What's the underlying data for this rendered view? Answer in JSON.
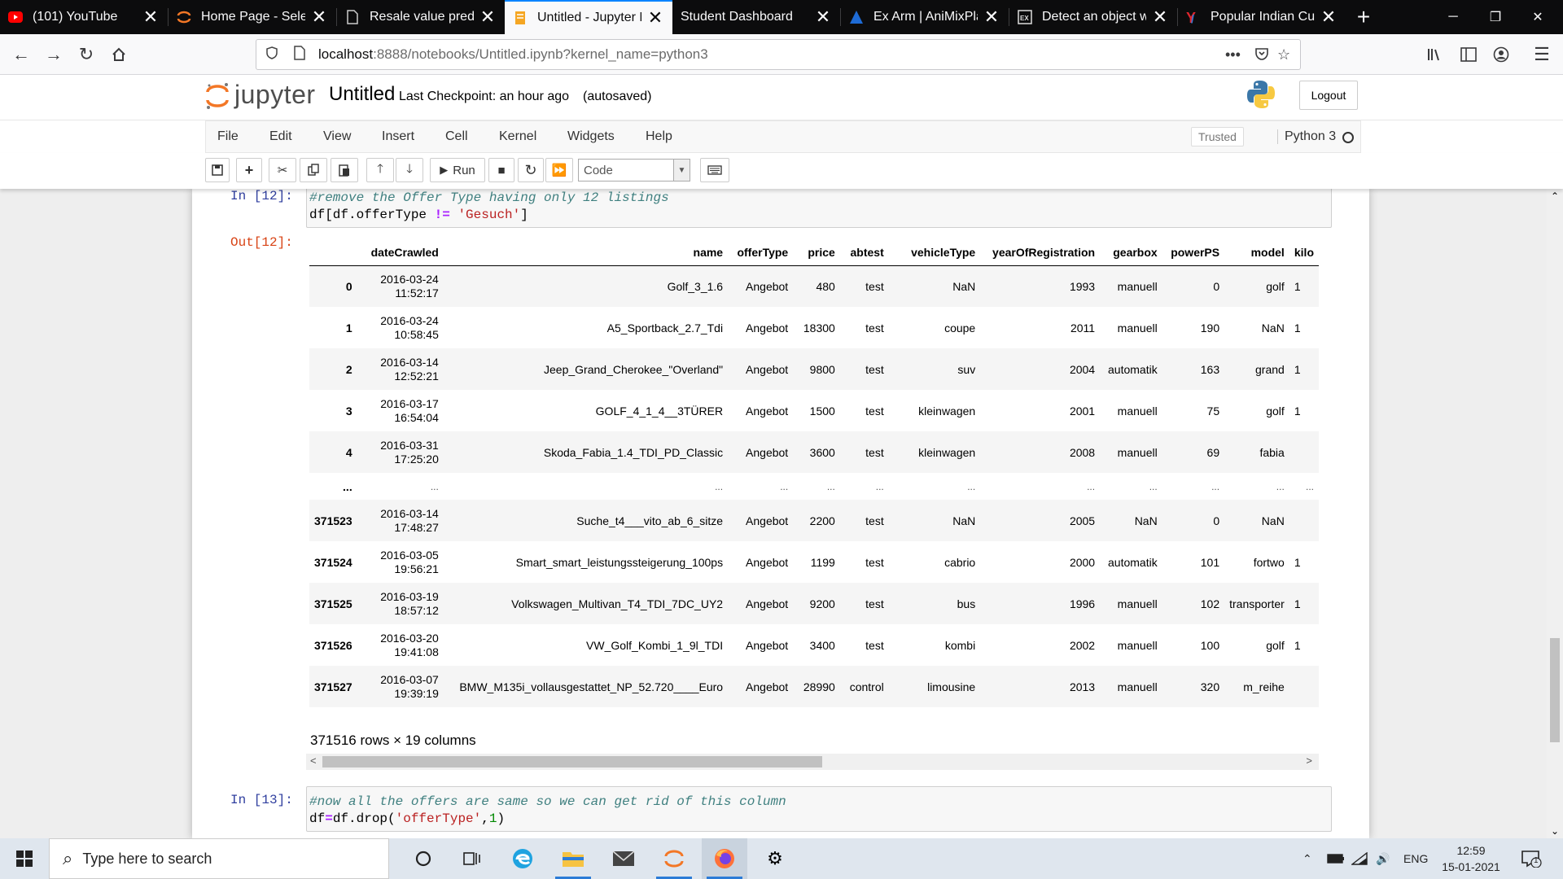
{
  "browser": {
    "tabs": [
      {
        "title": "(101) YouTube",
        "icon": "youtube-icon",
        "active": false
      },
      {
        "title": "Home Page - Select",
        "icon": "jupyter-tab-icon",
        "active": false
      },
      {
        "title": "Resale value predic",
        "icon": "document-icon",
        "active": false
      },
      {
        "title": "Untitled - Jupyter N",
        "icon": "jupyter-notebook-icon",
        "active": true
      },
      {
        "title": "Student Dashboard",
        "icon": "",
        "active": false
      },
      {
        "title": "Ex Arm | AniMixPlay",
        "icon": "animixplay-icon",
        "active": false
      },
      {
        "title": "Detect an object wi",
        "icon": "exe-icon",
        "active": false
      },
      {
        "title": "Popular Indian Cute",
        "icon": "y-icon",
        "active": false
      }
    ],
    "url_host": "localhost",
    "url_rest": ":8888/notebooks/Untitled.ipynb?kernel_name=python3"
  },
  "jupyter": {
    "logo_text": "jupyter",
    "notebook_name": "Untitled",
    "checkpoint": "Last Checkpoint: an hour ago",
    "autosave": "(autosaved)",
    "logout": "Logout",
    "menu": [
      "File",
      "Edit",
      "View",
      "Insert",
      "Cell",
      "Kernel",
      "Widgets",
      "Help"
    ],
    "trusted": "Trusted",
    "kernel": "Python 3",
    "toolbar": {
      "run_label": "Run",
      "cell_type": "Code"
    }
  },
  "cells": {
    "cell12": {
      "in_prompt": "In [12]:",
      "out_prompt": "Out[12]:",
      "line1": "#remove the Offer Type having only 12 listings",
      "line2_a": "df[df.offerType ",
      "line2_op": "!=",
      "line2_b": " ",
      "line2_str": "'Gesuch'",
      "line2_c": "]"
    },
    "cell13": {
      "in_prompt": "In [13]:",
      "line1": "#now all the offers are same so we can get rid of this column",
      "line2_a": "df",
      "line2_op": "=",
      "line2_b": "df.drop(",
      "line2_str": "'offerType'",
      "line2_c": ",",
      "line2_num": "1",
      "line2_d": ")"
    }
  },
  "dataframe": {
    "columns": [
      "",
      "dateCrawled",
      "name",
      "offerType",
      "price",
      "abtest",
      "vehicleType",
      "yearOfRegistration",
      "gearbox",
      "powerPS",
      "model",
      "kilo"
    ],
    "rows": [
      {
        "idx": "0",
        "date": "2016-03-24",
        "time": "11:52:17",
        "name": "Golf_3_1.6",
        "offerType": "Angebot",
        "price": "480",
        "abtest": "test",
        "vehicleType": "NaN",
        "year": "1993",
        "gearbox": "manuell",
        "powerPS": "0",
        "model": "golf",
        "kilo": "1"
      },
      {
        "idx": "1",
        "date": "2016-03-24",
        "time": "10:58:45",
        "name": "A5_Sportback_2.7_Tdi",
        "offerType": "Angebot",
        "price": "18300",
        "abtest": "test",
        "vehicleType": "coupe",
        "year": "2011",
        "gearbox": "manuell",
        "powerPS": "190",
        "model": "NaN",
        "kilo": "1"
      },
      {
        "idx": "2",
        "date": "2016-03-14",
        "time": "12:52:21",
        "name": "Jeep_Grand_Cherokee_\"Overland\"",
        "offerType": "Angebot",
        "price": "9800",
        "abtest": "test",
        "vehicleType": "suv",
        "year": "2004",
        "gearbox": "automatik",
        "powerPS": "163",
        "model": "grand",
        "kilo": "1"
      },
      {
        "idx": "3",
        "date": "2016-03-17",
        "time": "16:54:04",
        "name": "GOLF_4_1_4__3TÜRER",
        "offerType": "Angebot",
        "price": "1500",
        "abtest": "test",
        "vehicleType": "kleinwagen",
        "year": "2001",
        "gearbox": "manuell",
        "powerPS": "75",
        "model": "golf",
        "kilo": "1"
      },
      {
        "idx": "4",
        "date": "2016-03-31",
        "time": "17:25:20",
        "name": "Skoda_Fabia_1.4_TDI_PD_Classic",
        "offerType": "Angebot",
        "price": "3600",
        "abtest": "test",
        "vehicleType": "kleinwagen",
        "year": "2008",
        "gearbox": "manuell",
        "powerPS": "69",
        "model": "fabia",
        "kilo": ""
      },
      {
        "idx": "...",
        "ellipsis": true
      },
      {
        "idx": "371523",
        "date": "2016-03-14",
        "time": "17:48:27",
        "name": "Suche_t4___vito_ab_6_sitze",
        "offerType": "Angebot",
        "price": "2200",
        "abtest": "test",
        "vehicleType": "NaN",
        "year": "2005",
        "gearbox": "NaN",
        "powerPS": "0",
        "model": "NaN",
        "kilo": ""
      },
      {
        "idx": "371524",
        "date": "2016-03-05",
        "time": "19:56:21",
        "name": "Smart_smart_leistungssteigerung_100ps",
        "offerType": "Angebot",
        "price": "1199",
        "abtest": "test",
        "vehicleType": "cabrio",
        "year": "2000",
        "gearbox": "automatik",
        "powerPS": "101",
        "model": "fortwo",
        "kilo": "1"
      },
      {
        "idx": "371525",
        "date": "2016-03-19",
        "time": "18:57:12",
        "name": "Volkswagen_Multivan_T4_TDI_7DC_UY2",
        "offerType": "Angebot",
        "price": "9200",
        "abtest": "test",
        "vehicleType": "bus",
        "year": "1996",
        "gearbox": "manuell",
        "powerPS": "102",
        "model": "transporter",
        "kilo": "1"
      },
      {
        "idx": "371526",
        "date": "2016-03-20",
        "time": "19:41:08",
        "name": "VW_Golf_Kombi_1_9l_TDI",
        "offerType": "Angebot",
        "price": "3400",
        "abtest": "test",
        "vehicleType": "kombi",
        "year": "2002",
        "gearbox": "manuell",
        "powerPS": "100",
        "model": "golf",
        "kilo": "1"
      },
      {
        "idx": "371527",
        "date": "2016-03-07",
        "time": "19:39:19",
        "name": "BMW_M135i_vollausgestattet_NP_52.720____Euro",
        "offerType": "Angebot",
        "price": "28990",
        "abtest": "control",
        "vehicleType": "limousine",
        "year": "2013",
        "gearbox": "manuell",
        "powerPS": "320",
        "model": "m_reihe",
        "kilo": ""
      }
    ],
    "summary": "371516 rows × 19 columns"
  },
  "taskbar": {
    "search_placeholder": "Type here to search",
    "lang": "ENG",
    "time": "12:59",
    "date": "15-01-2021",
    "notification_count": "1"
  }
}
